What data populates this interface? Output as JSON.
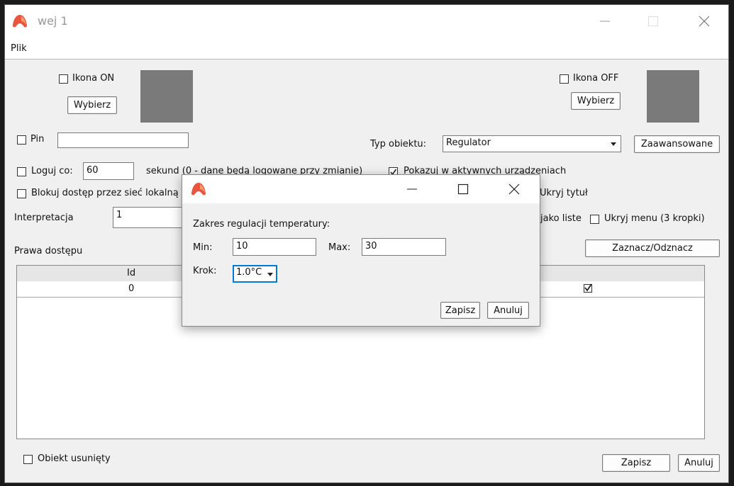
{
  "window": {
    "title": "wej 1"
  },
  "menu": {
    "file": "Plik"
  },
  "icon_on": {
    "checkbox_label": "Ikona ON",
    "choose_button": "Wybierz"
  },
  "icon_off": {
    "checkbox_label": "Ikona OFF",
    "choose_button": "Wybierz"
  },
  "pin": {
    "label": "Pin",
    "value": ""
  },
  "object_type": {
    "label": "Typ obiektu:",
    "selected": "Regulator",
    "advanced_button": "Zaawansowane"
  },
  "log": {
    "label": "Loguj co:",
    "value": "60",
    "suffix": "sekund (0 - dane będą logowane przy zmianie)"
  },
  "show_active": {
    "label": "Pokazuj w aktywnych urządzeniach",
    "checked": true
  },
  "block_access": {
    "label": "Blokuj dostęp przez sieć lokalną"
  },
  "hide_title": {
    "label": "Ukryj tytuł"
  },
  "interpretation": {
    "label": "Interpretacja",
    "value": "1"
  },
  "as_list": {
    "label": "jako liste"
  },
  "hide_menu": {
    "label": "Ukryj menu (3 kropki)"
  },
  "permissions": {
    "label": "Prawa dostępu",
    "toggle_button": "Zaznacz/Odznacz",
    "columns": [
      "Id"
    ],
    "rows": [
      {
        "id": "0",
        "checked": true
      }
    ]
  },
  "deleted": {
    "label": "Obiekt usunięty"
  },
  "footer": {
    "save": "Zapisz",
    "cancel": "Anuluj"
  },
  "dialog": {
    "heading": "Zakres regulacji temperatury:",
    "min_label": "Min:",
    "min_value": "10",
    "max_label": "Max:",
    "max_value": "30",
    "step_label": "Krok:",
    "step_value": "1.0°C",
    "save": "Zapisz",
    "cancel": "Anuluj"
  },
  "colors": {
    "accent": "#e8553f",
    "swatch": "#7a7a7a",
    "focus": "#0078d7"
  }
}
